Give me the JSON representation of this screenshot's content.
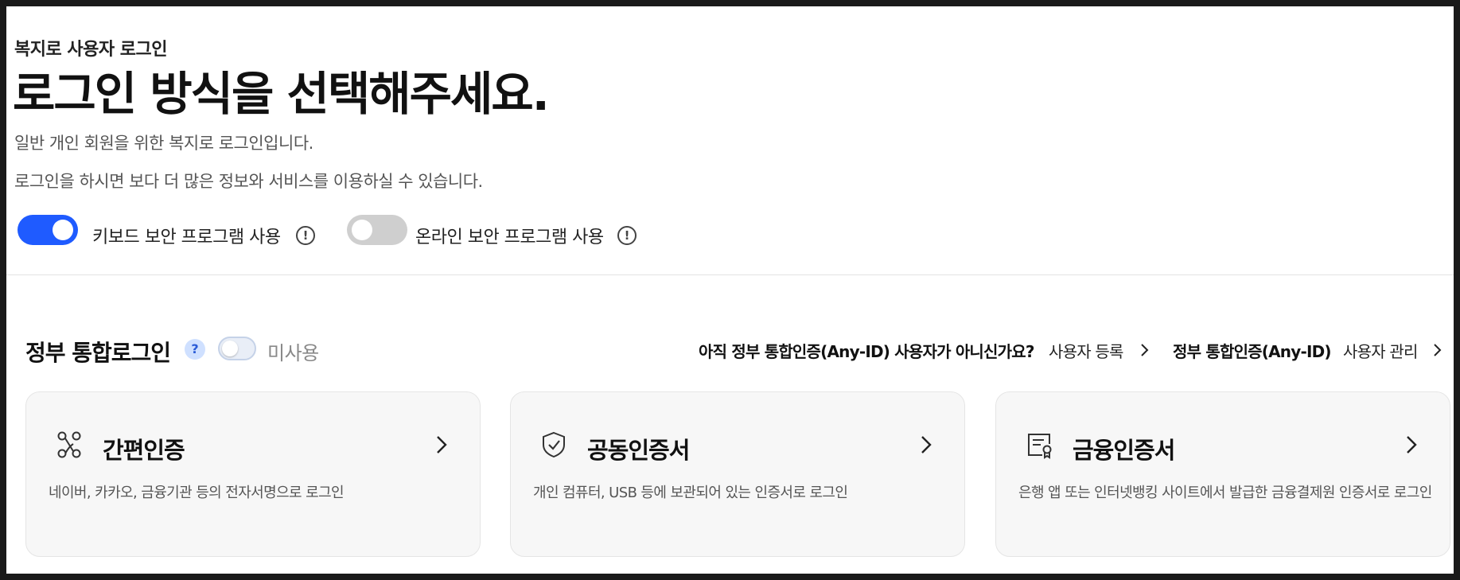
{
  "header": {
    "eyebrow": "복지로 사용자 로그인",
    "headline": "로그인 방식을 선택해주세요.",
    "desc1": "일반 개인 회원을 위한 복지로 로그인입니다.",
    "desc2": "로그인을 하시면 보다 더 많은 정보와 서비스를 이용하실 수 있습니다."
  },
  "security": {
    "keyboard": {
      "label": "키보드 보안 프로그램 사용",
      "on": true
    },
    "online": {
      "label": "온라인 보안 프로그램 사용",
      "on": false
    },
    "info_glyph": "!"
  },
  "gov_login": {
    "title": "정부 통합로그인",
    "help_glyph": "?",
    "toggle_label": "미사용",
    "toggle_on": false,
    "prompt": "아직 정부 통합인증(Any-ID) 사용자가 아니신가요?",
    "register_link": "사용자 등록",
    "anyid_label": "정부 통합인증(Any-ID)",
    "manage_link": "사용자 관리"
  },
  "cards": [
    {
      "title": "간편인증",
      "desc": "네이버, 카카오, 금융기관 등의 전자서명으로 로그인",
      "icon": "network-icon"
    },
    {
      "title": "공동인증서",
      "desc": "개인 컴퓨터, USB 등에 보관되어 있는 인증서로 로그인",
      "icon": "shield-check-icon"
    },
    {
      "title": "금융인증서",
      "desc": "은행 앱 또는 인터넷뱅킹 사이트에서 발급한 금융결제원 인증서로 로그인",
      "icon": "certificate-icon"
    }
  ],
  "colors": {
    "accent": "#1f5bff",
    "toggle_off": "#cfcfcf",
    "card_bg": "#f7f7f7"
  }
}
